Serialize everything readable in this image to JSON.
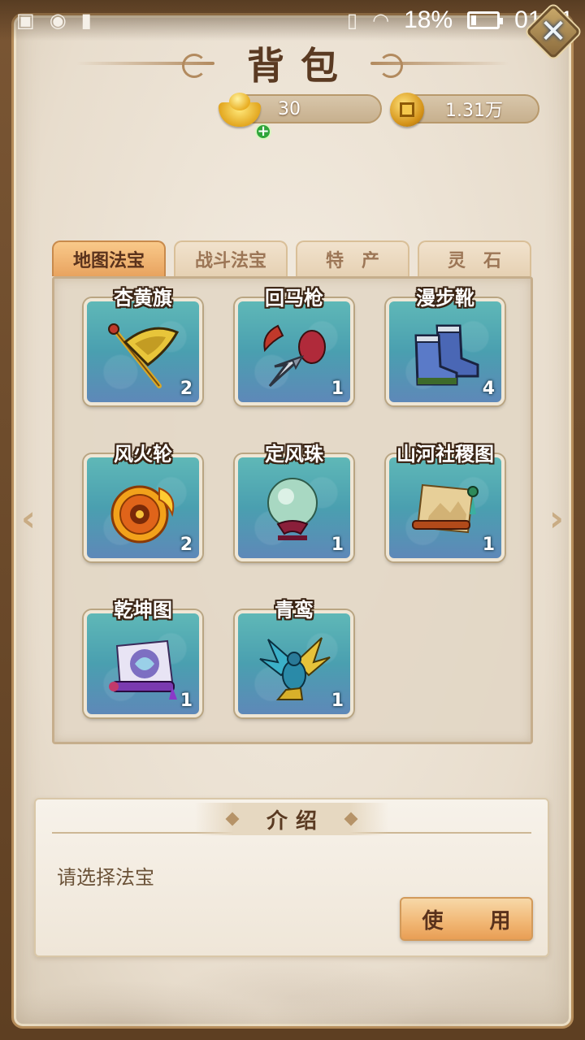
{
  "status_bar": {
    "battery": "18%",
    "time": "01:11",
    "battery_level": 0.18
  },
  "title": "背包",
  "currency": {
    "gold": "30",
    "coins": "1.31万"
  },
  "tabs": [
    {
      "label": "地图法宝",
      "active": true
    },
    {
      "label": "战斗法宝",
      "active": false
    },
    {
      "label": "特产",
      "active": false
    },
    {
      "label": "灵石",
      "active": false
    }
  ],
  "items": [
    {
      "name": "杏黄旗",
      "count": "2",
      "icon": "apricot-banner-icon"
    },
    {
      "name": "回马枪",
      "count": "1",
      "icon": "spear-icon"
    },
    {
      "name": "漫步靴",
      "count": "4",
      "icon": "boots-icon"
    },
    {
      "name": "风火轮",
      "count": "2",
      "icon": "fire-wheel-icon"
    },
    {
      "name": "定风珠",
      "count": "1",
      "icon": "wind-pearl-icon"
    },
    {
      "name": "山河社稷图",
      "count": "1",
      "icon": "landscape-scroll-icon"
    },
    {
      "name": "乾坤图",
      "count": "1",
      "icon": "cosmos-scroll-icon"
    },
    {
      "name": "青鸾",
      "count": "1",
      "icon": "phoenix-icon"
    }
  ],
  "intro": {
    "title": "介绍",
    "text": "请选择法宝",
    "use_button": "使 用"
  }
}
